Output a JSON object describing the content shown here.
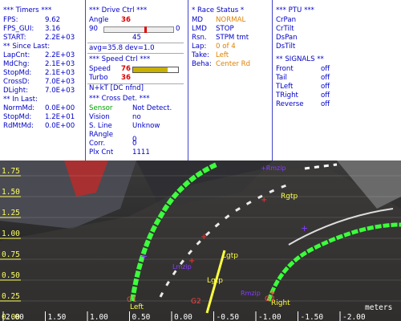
{
  "timers": {
    "header": "*** Timers ***",
    "rows": [
      {
        "label": "FPS:",
        "value": "9.62"
      },
      {
        "label": "FPS_GUI:",
        "value": "3.16"
      },
      {
        "label": "START:",
        "value": "2.2E+03"
      }
    ],
    "since_header": "** Since Last:",
    "since_rows": [
      {
        "label": "LapCnt:",
        "value": "2.2E+03"
      },
      {
        "label": "MdChg:",
        "value": "2.1E+03"
      },
      {
        "label": "StopMd:",
        "value": "2.1E+03"
      },
      {
        "label": "CrossD:",
        "value": "7.0E+03"
      },
      {
        "label": "DLight:",
        "value": "7.0E+03"
      }
    ],
    "in_header": "** In Last:",
    "in_rows": [
      {
        "label": "NormMd:",
        "value": "0.0E+00"
      },
      {
        "label": "StopMd:",
        "value": "1.2E+01"
      },
      {
        "label": "RdMtMd:",
        "value": "0.0E+00"
      }
    ]
  },
  "drive": {
    "header": "***  Drive Ctrl  ***",
    "angle_label": "Angle",
    "angle_value": "36",
    "range_min": "90",
    "range_max": "0",
    "range_mid": "45",
    "slider_fraction": 0.6,
    "avg_text": "avg=35.8  dev=1.0",
    "speed_header": "***  Speed Ctrl  ***",
    "speed_label": "Speed",
    "speed_value": "76",
    "speed_fraction": 0.76,
    "turbo_label": "Turbo",
    "turbo_value": "36",
    "cross_header": "*** Cross Det. ***",
    "cross_rows": [
      {
        "label": "Sensor",
        "value": "Not Detect."
      },
      {
        "label": "Vision",
        "value": "no"
      },
      {
        "label": "S. Line",
        "value": "Unknow"
      },
      {
        "label": "RAngle",
        "value": "0"
      },
      {
        "label": "Corr.",
        "value": "0"
      },
      {
        "label": "Plx Cnt",
        "value": "1111"
      }
    ],
    "nkt_text": "N+kT [DC nfnd]"
  },
  "race": {
    "header": "* Race Status *",
    "rows": [
      {
        "label": "MD",
        "value": "NORMAL"
      },
      {
        "label": "LMD",
        "value": "STOP"
      },
      {
        "label": "Rsn.",
        "value": "STPM tmt"
      },
      {
        "label": "Lap:",
        "value": "0 of 4"
      },
      {
        "label": "Take:",
        "value": "Left"
      },
      {
        "label": "Beha:",
        "value": "Center Rd"
      }
    ]
  },
  "ptu": {
    "header": "*** PTU ***",
    "items": [
      "CrPan",
      "CrTilt",
      "DsPan",
      "DsTilt"
    ],
    "signals_header": "** SIGNALS **",
    "signals": [
      {
        "label": "Front",
        "value": "off"
      },
      {
        "label": "Tail",
        "value": "off"
      },
      {
        "label": "TLeft",
        "value": "off"
      },
      {
        "label": "TRight",
        "value": "off"
      },
      {
        "label": "Reverse",
        "value": "off"
      }
    ]
  },
  "camera": {
    "y_ticks": [
      "1.75",
      "1.50",
      "1.25",
      "1.00",
      "0.75",
      "0.50",
      "0.25",
      "0.00"
    ],
    "x_ticks": [
      "2.00",
      "1.50",
      "1.00",
      "0.50",
      "0.00",
      "-0.50",
      "-1.00",
      "-1.50",
      "-2.00"
    ],
    "x_unit": "meters",
    "labels": {
      "rgtp_top": "Rgtp",
      "rgtp_mid": "Rgtp",
      "lgtp_a": "Lgtp",
      "lgtp_b": "Lgtp",
      "lmzip": "Lmzip",
      "rmzip": "Rmzip",
      "left": "Left",
      "right": "Right",
      "g1": "G1",
      "g2": "G2",
      "g3": "G3"
    },
    "colors": {
      "lane_green": "#3cff3c",
      "label_yellow": "#ffff40",
      "marker_purple": "#8a3cff",
      "marker_red": "#ff3030"
    }
  }
}
